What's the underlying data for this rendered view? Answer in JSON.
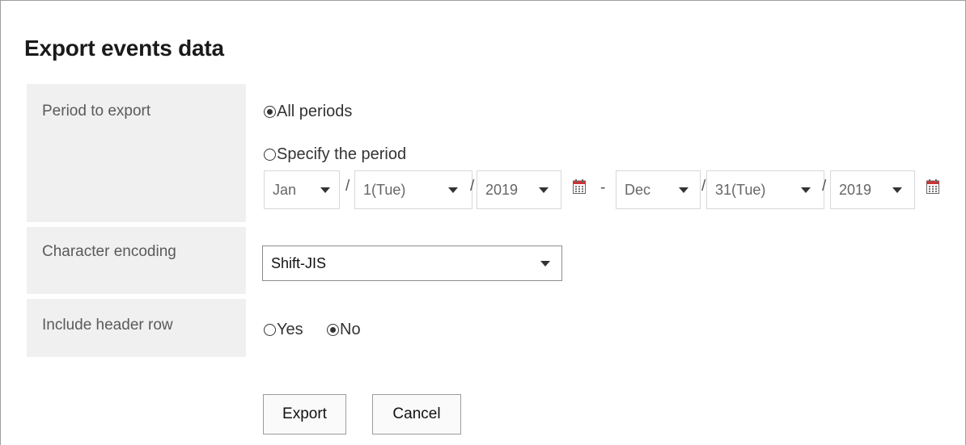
{
  "title": "Export events data",
  "period": {
    "label": "Period to export",
    "all_label": "All periods",
    "specify_label": "Specify the period",
    "selected": "all",
    "start": {
      "month": "Jan",
      "day": "1(Tue)",
      "year": "2019"
    },
    "end": {
      "month": "Dec",
      "day": "31(Tue)",
      "year": "2019"
    },
    "separator": "/",
    "range_dash": "-"
  },
  "encoding": {
    "label": "Character encoding",
    "value": "Shift-JIS"
  },
  "header_row": {
    "label": "Include header row",
    "yes_label": "Yes",
    "no_label": "No",
    "selected": "no"
  },
  "buttons": {
    "export": "Export",
    "cancel": "Cancel"
  },
  "icons": {
    "calendar": "calendar-icon",
    "dropdown": "chevron-down-icon",
    "calendar_color": "#cc3333"
  }
}
